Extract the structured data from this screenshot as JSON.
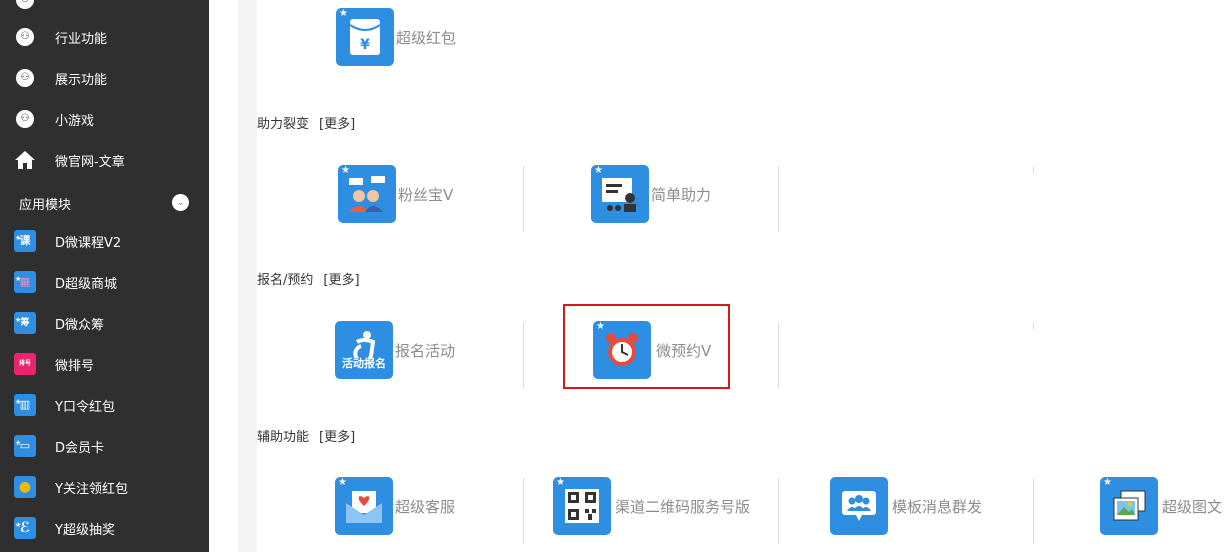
{
  "sidebar": {
    "items": [
      {
        "label": "行业功能"
      },
      {
        "label": "展示功能"
      },
      {
        "label": "小游戏"
      },
      {
        "label": "微官网-文章"
      }
    ],
    "section_title": "应用模块",
    "apps": [
      {
        "label": "D微课程V2",
        "icon_text": "课",
        "color": "#2e8fe2"
      },
      {
        "label": "D超级商城",
        "icon_text": "▤",
        "color": "#2e8fe2"
      },
      {
        "label": "D微众筹",
        "icon_text": "筹",
        "color": "#2e8fe2"
      },
      {
        "label": "微排号",
        "icon_text": "排号",
        "color": "#e8256e"
      },
      {
        "label": "Y口令红包",
        "icon_text": "▥",
        "color": "#2e8fe2"
      },
      {
        "label": "D会员卡",
        "icon_text": "▭",
        "color": "#2e8fe2"
      },
      {
        "label": "Y关注领红包",
        "icon_text": "●",
        "color": "#2e8fe2"
      },
      {
        "label": "Y超级抽奖",
        "icon_text": "ℰ",
        "color": "#2e8fe2"
      }
    ]
  },
  "main": {
    "top_card": {
      "label": "超级红包"
    },
    "sections": [
      {
        "title": "助力裂变",
        "more": "[更多]",
        "cards": [
          {
            "label": "粉丝宝V"
          },
          {
            "label": "简单助力"
          }
        ]
      },
      {
        "title": "报名/预约",
        "more": "[更多]",
        "cards": [
          {
            "label": "报名活动",
            "tile_text": "活动报名"
          },
          {
            "label": "微预约V"
          }
        ]
      },
      {
        "title": "辅助功能",
        "more": "[更多]",
        "cards": [
          {
            "label": "超级客服"
          },
          {
            "label": "渠道二维码服务号版"
          },
          {
            "label": "模板消息群发"
          },
          {
            "label": "超级图文"
          }
        ]
      }
    ]
  },
  "colors": {
    "sidebar_bg": "#2f2f2f",
    "tile_blue": "#2e8fe2",
    "highlight": "#d9161a",
    "label_gray": "#8c8c8c"
  }
}
